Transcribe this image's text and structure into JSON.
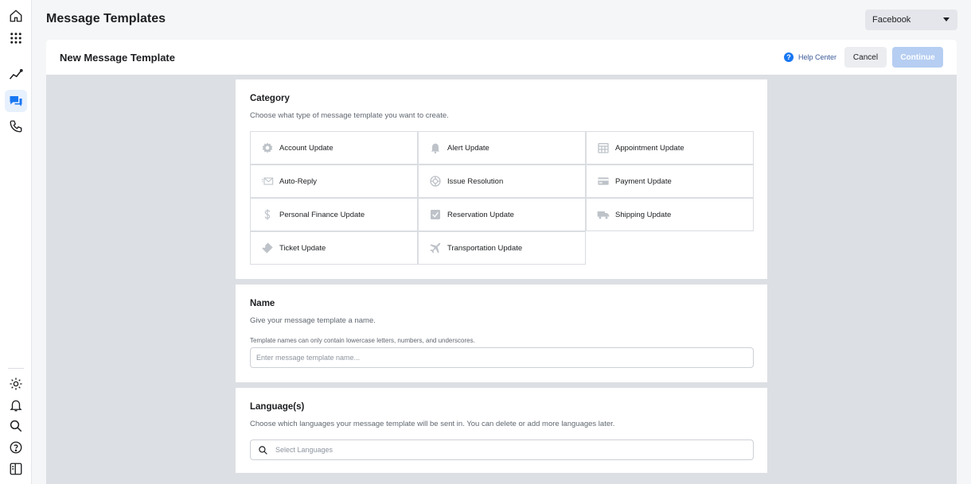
{
  "header": {
    "title": "Message Templates",
    "platform_select": "Facebook"
  },
  "rail": {
    "top_icons": [
      "home-icon",
      "apps-grid-icon",
      "insights-icon",
      "messages-icon",
      "phone-icon"
    ],
    "bottom_icons": [
      "settings-icon",
      "notifications-icon",
      "search-icon",
      "help-icon",
      "panel-toggle-icon"
    ],
    "active": "messages-icon",
    "accent_color": "#1877f2"
  },
  "modal": {
    "title": "New Message Template",
    "help_label": "Help Center",
    "cancel_label": "Cancel",
    "continue_label": "Continue"
  },
  "category": {
    "heading": "Category",
    "description": "Choose what type of message template you want to create.",
    "items": [
      {
        "label": "Account Update",
        "icon": "gear-icon"
      },
      {
        "label": "Alert Update",
        "icon": "bell-icon"
      },
      {
        "label": "Appointment Update",
        "icon": "calendar-icon"
      },
      {
        "label": "Auto-Reply",
        "icon": "envelope-icon"
      },
      {
        "label": "Issue Resolution",
        "icon": "lifebuoy-icon"
      },
      {
        "label": "Payment Update",
        "icon": "credit-card-icon"
      },
      {
        "label": "Personal Finance Update",
        "icon": "dollar-icon"
      },
      {
        "label": "Reservation Update",
        "icon": "checkbox-icon"
      },
      {
        "label": "Shipping Update",
        "icon": "truck-icon"
      },
      {
        "label": "Ticket Update",
        "icon": "ticket-icon"
      },
      {
        "label": "Transportation Update",
        "icon": "airplane-icon"
      }
    ]
  },
  "name": {
    "heading": "Name",
    "description": "Give your message template a name.",
    "note": "Template names can only contain lowercase letters, numbers, and underscores.",
    "placeholder": "Enter message template name..."
  },
  "languages": {
    "heading": "Language(s)",
    "description": "Choose which languages your message template will be sent in. You can delete or add more languages later.",
    "placeholder": "Select Languages"
  }
}
